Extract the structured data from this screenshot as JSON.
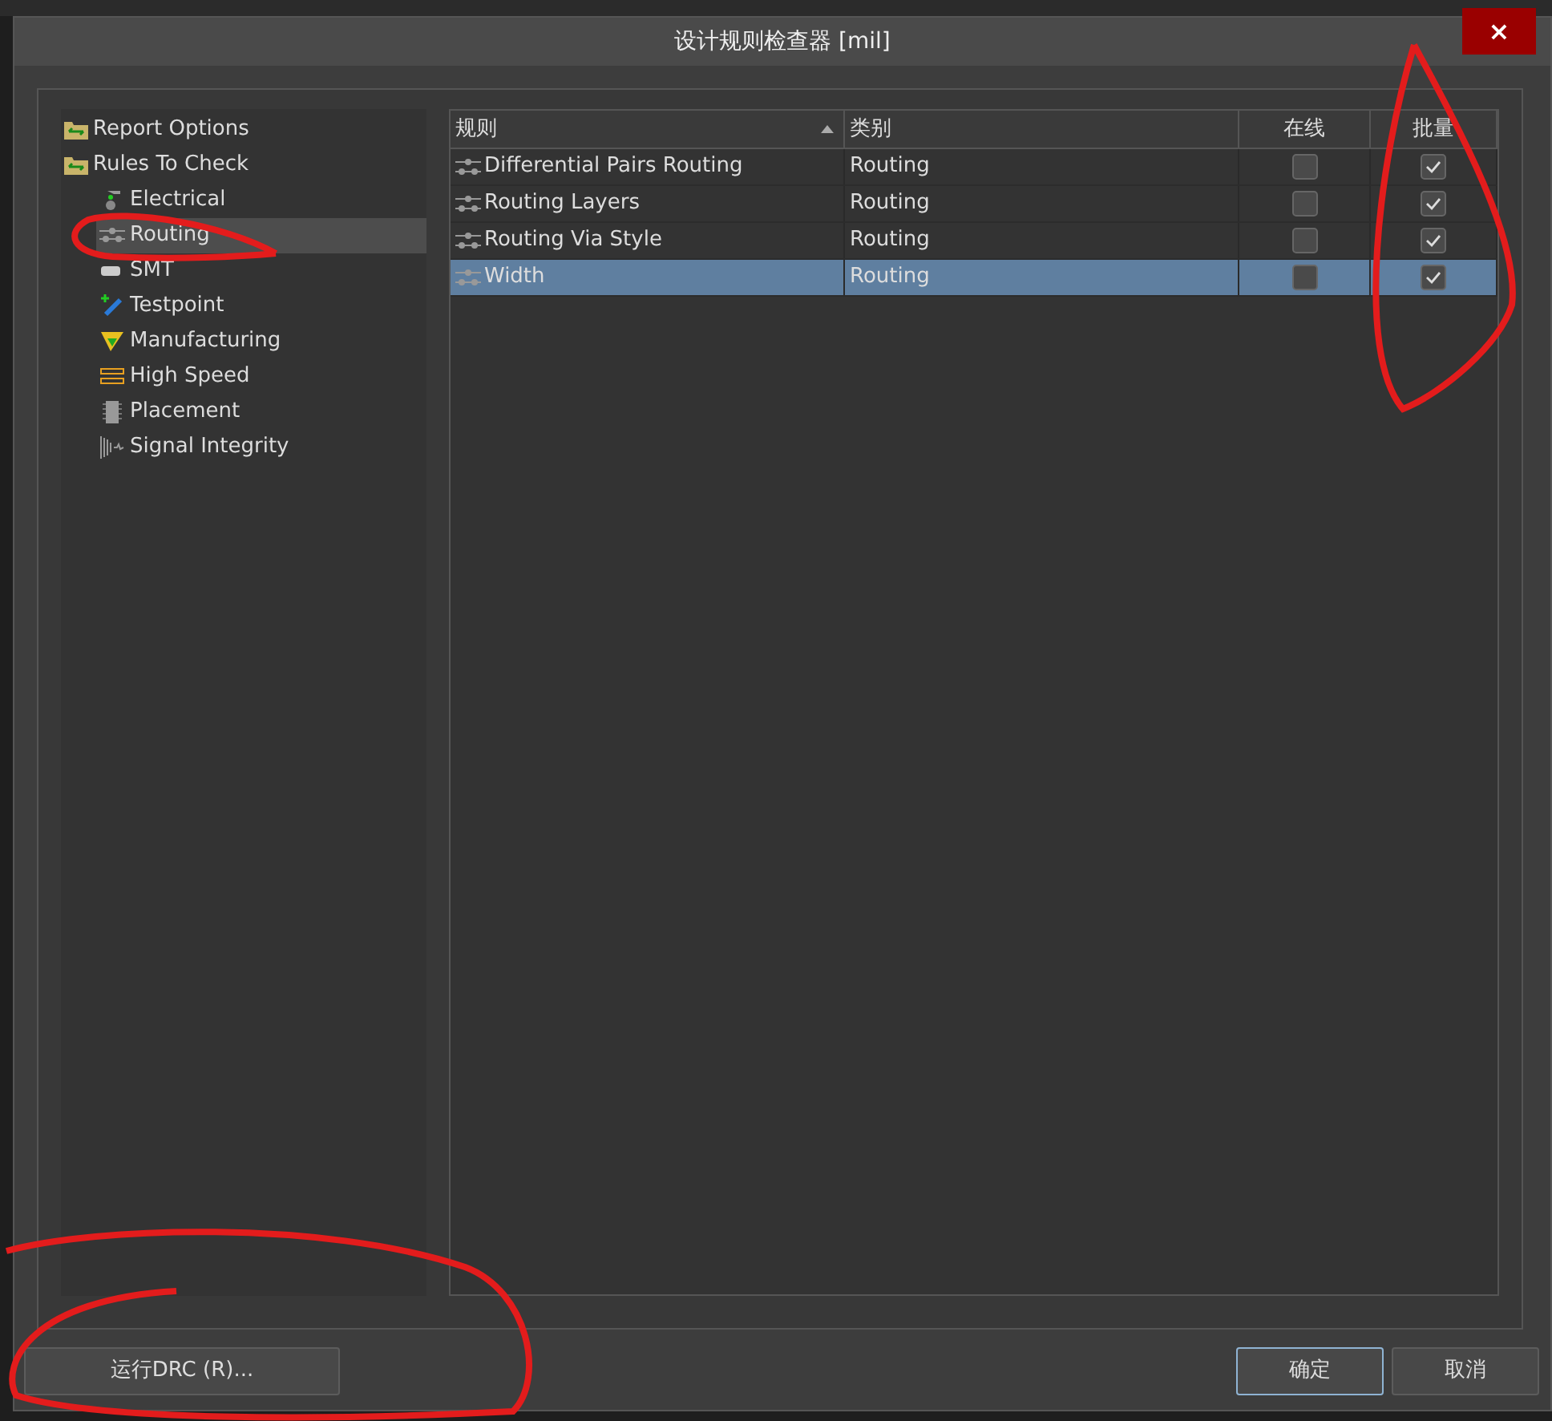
{
  "dialog": {
    "title": "设计规则检查器 [mil]",
    "close": "×"
  },
  "tree": [
    {
      "label": "Report Options",
      "selected": false
    },
    {
      "label": "Rules To Check",
      "selected": false,
      "children": [
        {
          "label": "Electrical",
          "selected": false
        },
        {
          "label": "Routing",
          "selected": true
        },
        {
          "label": "SMT",
          "selected": false
        },
        {
          "label": "Testpoint",
          "selected": false
        },
        {
          "label": "Manufacturing",
          "selected": false
        },
        {
          "label": "High Speed",
          "selected": false
        },
        {
          "label": "Placement",
          "selected": false
        },
        {
          "label": "Signal Integrity",
          "selected": false
        }
      ]
    }
  ],
  "table": {
    "columns": [
      "规则",
      "类别",
      "在线",
      "批量"
    ],
    "rows": [
      {
        "rule": "Differential Pairs Routing",
        "category": "Routing",
        "online": false,
        "batch": true,
        "selected": false
      },
      {
        "rule": "Routing Layers",
        "category": "Routing",
        "online": false,
        "batch": true,
        "selected": false
      },
      {
        "rule": "Routing Via Style",
        "category": "Routing",
        "online": false,
        "batch": true,
        "selected": false
      },
      {
        "rule": "Width",
        "category": "Routing",
        "online": false,
        "batch": true,
        "selected": true
      }
    ]
  },
  "buttons": {
    "run": "运行DRC (R)...",
    "ok": "确定",
    "cancel": "取消"
  }
}
